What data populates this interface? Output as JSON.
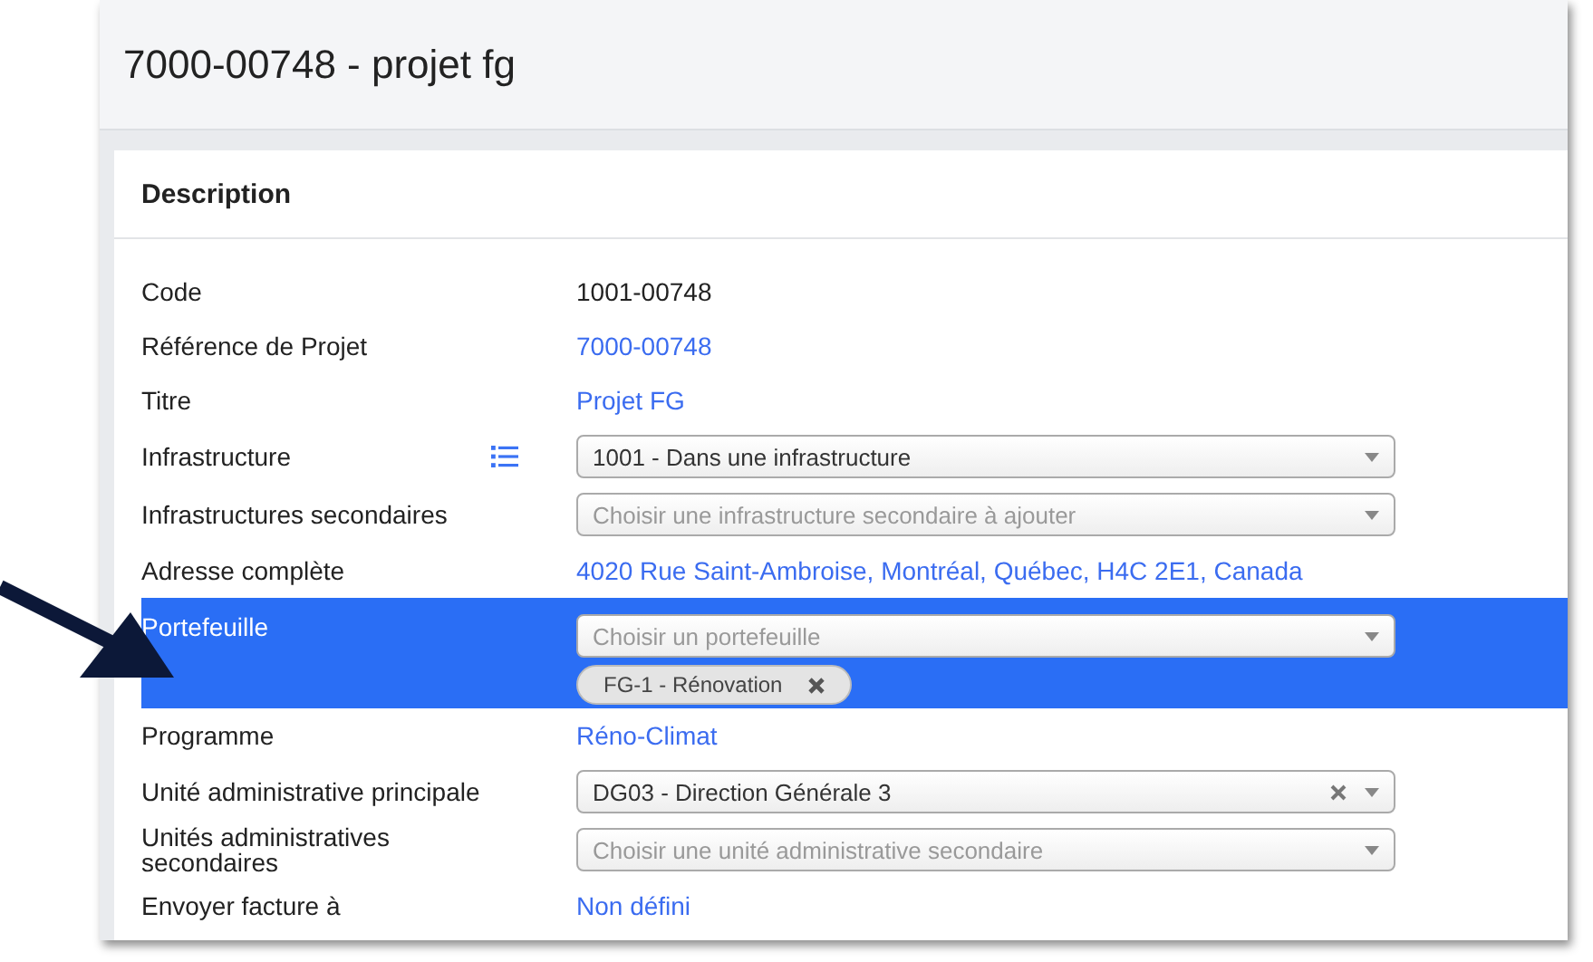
{
  "page": {
    "title": "7000-00748 - projet fg"
  },
  "card": {
    "title": "Description",
    "fields": [
      {
        "label": "Code",
        "kind": "text",
        "value": "1001-00748",
        "highlighted": false
      },
      {
        "label": "Référence de Projet",
        "kind": "link",
        "value": "7000-00748",
        "highlighted": false
      },
      {
        "label": "Titre",
        "kind": "link",
        "value": "Projet FG",
        "highlighted": false
      },
      {
        "label": "Infrastructure",
        "kind": "select",
        "value": "1001 - Dans une infrastructure",
        "list_icon": true,
        "clearable": false,
        "highlighted": false
      },
      {
        "label": "Infrastructures secondaires",
        "kind": "select",
        "placeholder": "Choisir une infrastructure secondaire à ajouter",
        "clearable": false,
        "highlighted": false
      },
      {
        "label": "Adresse complète",
        "kind": "link",
        "value": "4020 Rue Saint-Ambroise, Montréal, Québec, H4C 2E1, Canada",
        "highlighted": false
      },
      {
        "label": "Portefeuille",
        "kind": "select",
        "placeholder": "Choisir un portefeuille",
        "clearable": false,
        "highlighted": true,
        "tags": [
          "FG-1 - Rénovation"
        ]
      },
      {
        "label": "Programme",
        "kind": "link",
        "value": "Réno-Climat",
        "highlighted": false
      },
      {
        "label": "Unité administrative principale",
        "kind": "select",
        "value": "DG03 - Direction Générale 3",
        "clearable": true,
        "highlighted": false
      },
      {
        "label": "Unités administratives secondaires",
        "kind": "select",
        "placeholder": "Choisir une unité administrative secondaire",
        "clearable": false,
        "highlighted": false
      },
      {
        "label": "Envoyer facture à",
        "kind": "link",
        "value": "Non défini",
        "highlighted": false
      }
    ]
  },
  "annotation": {
    "kind": "arrow"
  }
}
